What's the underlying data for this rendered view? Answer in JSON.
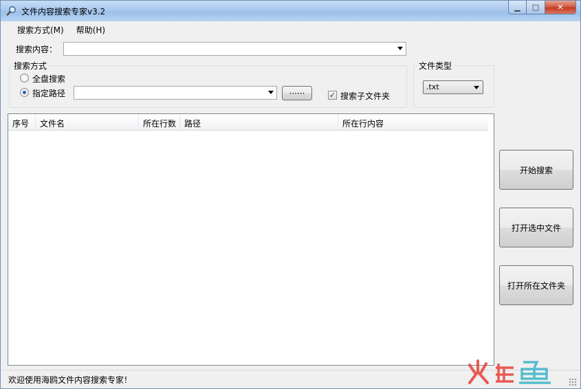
{
  "window": {
    "title": "文件内容搜索专家v3.2",
    "icon": "magnifier-icon"
  },
  "menu": {
    "items": [
      "搜索方式(M)",
      "帮助(H)"
    ]
  },
  "search_content": {
    "label": "搜索内容：",
    "value": ""
  },
  "search_mode": {
    "group_title": "搜索方式",
    "full_disk_label": "全盘搜索",
    "specific_path_label": "指定路径",
    "selected": "指定路径",
    "path_value": "",
    "browse_label": "······",
    "subfolder_label": "搜索子文件夹",
    "subfolder_checked": true
  },
  "file_type": {
    "group_title": "文件类型",
    "selected": ".txt"
  },
  "results_table": {
    "columns": [
      "序号",
      "文件名",
      "所在行数",
      "路径",
      "所在行内容"
    ],
    "rows": []
  },
  "actions": {
    "start_search": "开始搜索",
    "open_selected": "打开选中文件",
    "open_folder": "打开所在文件夹"
  },
  "status": {
    "text": "欢迎使用海鸥文件内容搜索专家！"
  },
  "watermark": {
    "brand_colors": [
      "#e8413a",
      "#3ab3c9"
    ]
  }
}
